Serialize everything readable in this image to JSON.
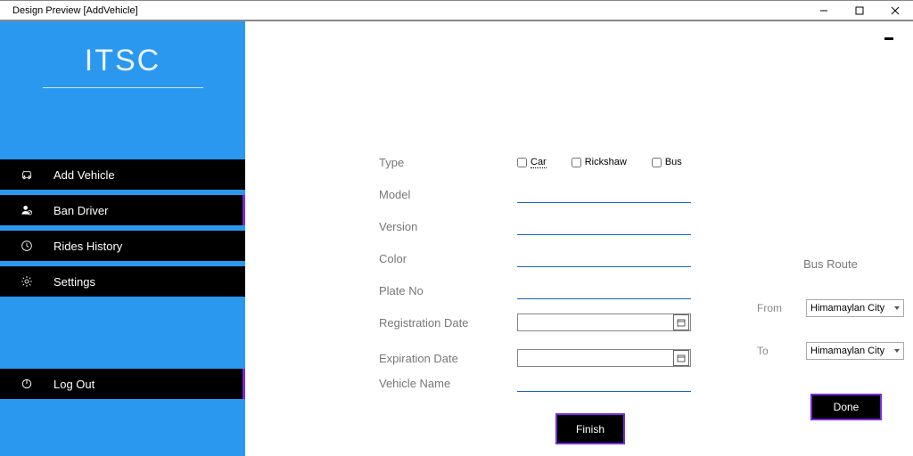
{
  "window": {
    "title": "Design Preview [AddVehicle]"
  },
  "sidebar": {
    "logo": "ITSC",
    "items": [
      {
        "label": "Add Vehicle"
      },
      {
        "label": "Ban Driver"
      },
      {
        "label": "Rides History"
      },
      {
        "label": "Settings"
      }
    ],
    "logout": "Log Out"
  },
  "form": {
    "type_label": "Type",
    "type_options": {
      "car": "Car",
      "rickshaw": "Rickshaw",
      "bus": "Bus"
    },
    "model_label": "Model",
    "version_label": "Version",
    "color_label": "Color",
    "plate_label": "Plate No",
    "regdate_label": "Registration Date",
    "expdate_label": "Expiration Date",
    "vname_label": "Vehicle Name",
    "finish": "Finish"
  },
  "busroute": {
    "title": "Bus Route",
    "from_label": "From",
    "to_label": "To",
    "from_value": "Himamaylan City",
    "to_value": "Himamaylan City",
    "done": "Done"
  }
}
